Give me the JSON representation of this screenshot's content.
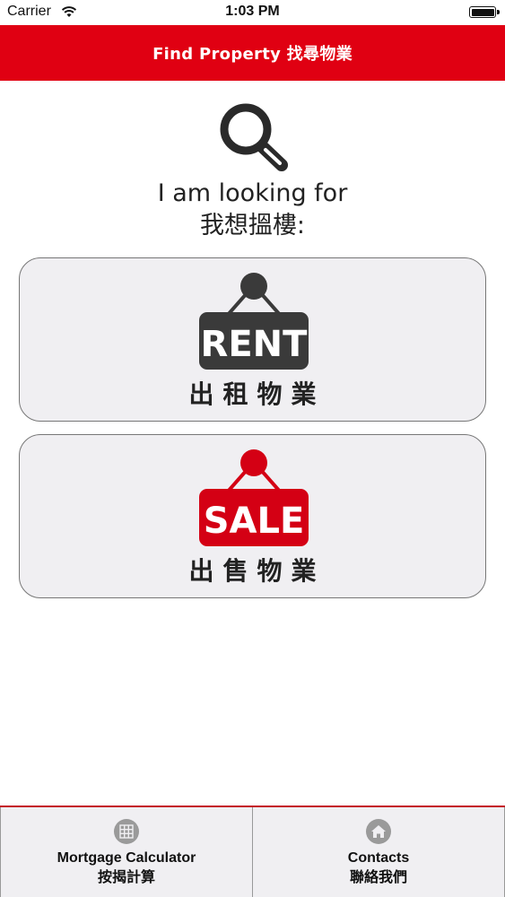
{
  "status_bar": {
    "carrier": "Carrier",
    "time": "1:03 PM"
  },
  "nav": {
    "title": "Find Property 找尋物業",
    "color": "#e00012"
  },
  "intro": {
    "icon": "search-icon",
    "line1": "I am looking for",
    "line2": "我想搵樓:"
  },
  "options": {
    "rent": {
      "sign_text": "RENT",
      "caption": "出租物業",
      "sign_color": "#3a3a3a"
    },
    "sale": {
      "sign_text": "SALE",
      "caption": "出售物業",
      "sign_color": "#d40014"
    }
  },
  "bottom_tabs": {
    "mortgage": {
      "icon": "calculator-icon",
      "label": "Mortgage Calculator",
      "sub": "按揭計算"
    },
    "contacts": {
      "icon": "home-icon",
      "label": "Contacts",
      "sub": "聯絡我們"
    }
  }
}
